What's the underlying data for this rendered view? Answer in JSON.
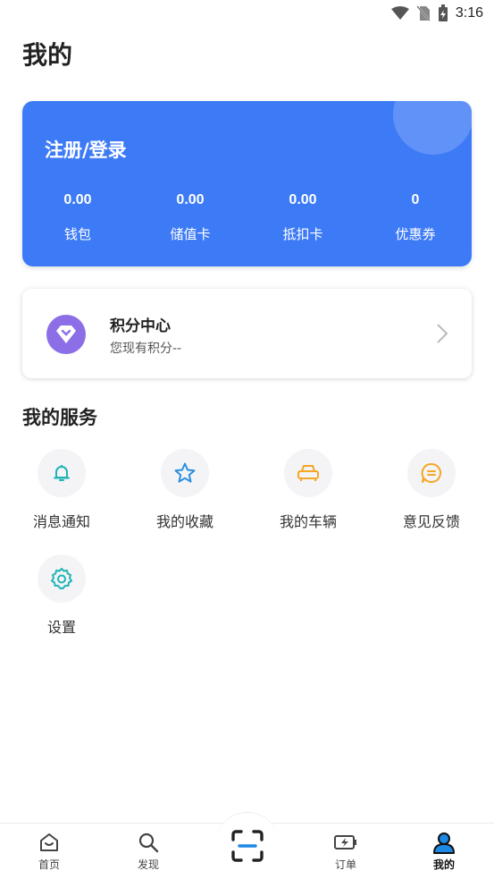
{
  "status_bar": {
    "time": "3:16"
  },
  "page": {
    "title": "我的"
  },
  "account_card": {
    "login_label": "注册/登录",
    "stats": [
      {
        "value": "0.00",
        "label": "钱包"
      },
      {
        "value": "0.00",
        "label": "储值卡"
      },
      {
        "value": "0.00",
        "label": "抵扣卡"
      },
      {
        "value": "0",
        "label": "优惠券"
      }
    ],
    "color": "#3D7BF6"
  },
  "points_card": {
    "title": "积分中心",
    "subtitle": "您现有积分--",
    "icon": "diamond-icon",
    "icon_color": "#8C6FE6"
  },
  "services": {
    "title": "我的服务",
    "items": [
      {
        "label": "消息通知",
        "icon": "bell-icon",
        "color": "#1FB5B5"
      },
      {
        "label": "我的收藏",
        "icon": "star-icon",
        "color": "#2B8FE0"
      },
      {
        "label": "我的车辆",
        "icon": "car-icon",
        "color": "#F5A623"
      },
      {
        "label": "意见反馈",
        "icon": "chat-icon",
        "color": "#F5A623"
      },
      {
        "label": "设置",
        "icon": "gear-icon",
        "color": "#1FB5B5"
      }
    ]
  },
  "tabbar": {
    "items": [
      {
        "label": "首页",
        "icon": "home-icon"
      },
      {
        "label": "发现",
        "icon": "search-icon"
      },
      {
        "label": "",
        "icon": "scan-icon"
      },
      {
        "label": "订单",
        "icon": "battery-charge-icon"
      },
      {
        "label": "我的",
        "icon": "user-icon",
        "active": true
      }
    ],
    "active_color": "#1E88E5"
  }
}
